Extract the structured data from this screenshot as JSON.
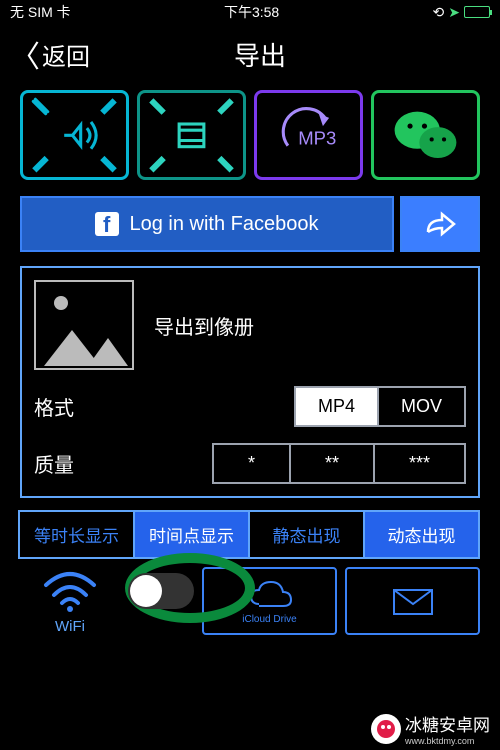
{
  "status_bar": {
    "left": "无 SIM 卡",
    "time": "下午3:58",
    "orientation_lock": "⊕",
    "location": "➤"
  },
  "header": {
    "back": "返回",
    "title": "导出"
  },
  "format_cards": {
    "mp3": "MP3"
  },
  "facebook": {
    "login": "Log in with Facebook"
  },
  "export": {
    "label": "导出到像册"
  },
  "format": {
    "label": "格式",
    "options": [
      "MP4",
      "MOV"
    ],
    "selected": "MP4"
  },
  "quality": {
    "label": "质量",
    "options": [
      "*",
      "**",
      "***"
    ]
  },
  "display_modes": [
    "等时长显示",
    "时间点显示",
    "静态出现",
    "动态出现"
  ],
  "display_selected": 1,
  "wifi": {
    "label": "WiFi"
  },
  "cloud": {
    "label": "iCloud Drive"
  },
  "watermark": {
    "name": "冰糖安卓网",
    "url": "www.bktdmy.com"
  }
}
